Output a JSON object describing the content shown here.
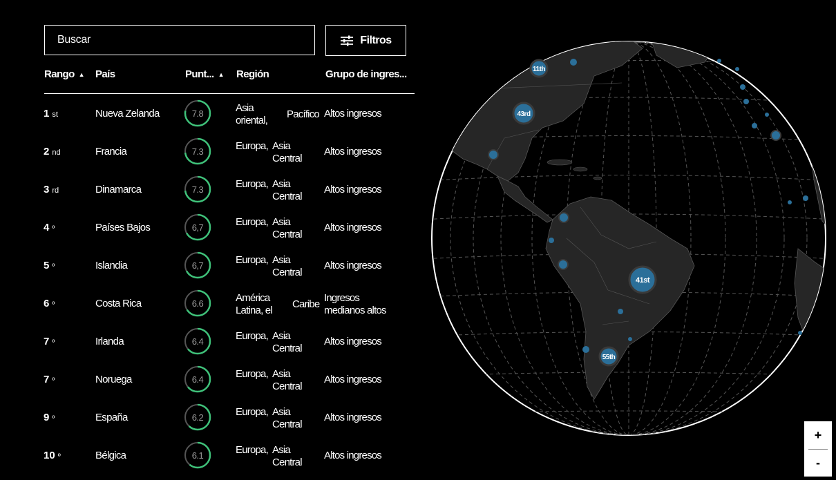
{
  "search": {
    "placeholder": "Buscar"
  },
  "filters": {
    "label": "Filtros",
    "icon": "sliders-icon"
  },
  "columns": {
    "rank": "Rango",
    "country": "País",
    "score": "Punt...",
    "region": "Región",
    "income": "Grupo de ingres..."
  },
  "rows": [
    {
      "rank": "1",
      "suffix": "st",
      "country": "Nueva Zelanda",
      "score": "7.8",
      "score_value": 7.8,
      "region_a": "Asia\noriental,",
      "region_b": "Pacífico",
      "income": "Altos ingresos"
    },
    {
      "rank": "2",
      "suffix": "nd",
      "country": "Francia",
      "score": "7.3",
      "score_value": 7.3,
      "region_a": "Europa,",
      "region_b": "Asia\nCentral",
      "income": "Altos ingresos"
    },
    {
      "rank": "3",
      "suffix": "rd",
      "country": "Dinamarca",
      "score": "7.3",
      "score_value": 7.3,
      "region_a": "Europa,",
      "region_b": "Asia\nCentral",
      "income": "Altos ingresos"
    },
    {
      "rank": "4",
      "suffix": "º",
      "country": "Países Bajos",
      "score": "6,7",
      "score_value": 6.7,
      "region_a": "Europa,",
      "region_b": "Asia\nCentral",
      "income": "Altos ingresos"
    },
    {
      "rank": "5",
      "suffix": "º",
      "country": "Islandia",
      "score": "6,7",
      "score_value": 6.7,
      "region_a": "Europa,",
      "region_b": "Asia\nCentral",
      "income": "Altos ingresos"
    },
    {
      "rank": "6",
      "suffix": "º",
      "country": "Costa Rica",
      "score": "6.6",
      "score_value": 6.6,
      "region_a": "América\nLatina, el",
      "region_b": "Caribe",
      "income": "Ingresos\nmedianos altos"
    },
    {
      "rank": "7",
      "suffix": "º",
      "country": "Irlanda",
      "score": "6.4",
      "score_value": 6.4,
      "region_a": "Europa,",
      "region_b": "Asia\nCentral",
      "income": "Altos ingresos"
    },
    {
      "rank": "7",
      "suffix": "º",
      "country": "Noruega",
      "score": "6.4",
      "score_value": 6.4,
      "region_a": "Europa,",
      "region_b": "Asia\nCentral",
      "income": "Altos ingresos"
    },
    {
      "rank": "9",
      "suffix": "º",
      "country": "España",
      "score": "6.2",
      "score_value": 6.2,
      "region_a": "Europa,",
      "region_b": "Asia\nCentral",
      "income": "Altos ingresos"
    },
    {
      "rank": "10",
      "suffix": "º",
      "country": "Bélgica",
      "score": "6.1",
      "score_value": 6.1,
      "region_a": "Europa,",
      "region_b": "Asia\nCentral",
      "income": "Altos ingresos"
    }
  ],
  "score_max": 10,
  "colors": {
    "ring": "#3fc27a",
    "ring_track": "#555555",
    "land": "#262626",
    "bubble": "#2b6f99"
  },
  "map": {
    "bubble_labels": {
      "canada": "11th",
      "usa": "43rd",
      "brazil": "41st",
      "argentina": "55th"
    }
  },
  "zoom": {
    "in": "+",
    "out": "-"
  }
}
